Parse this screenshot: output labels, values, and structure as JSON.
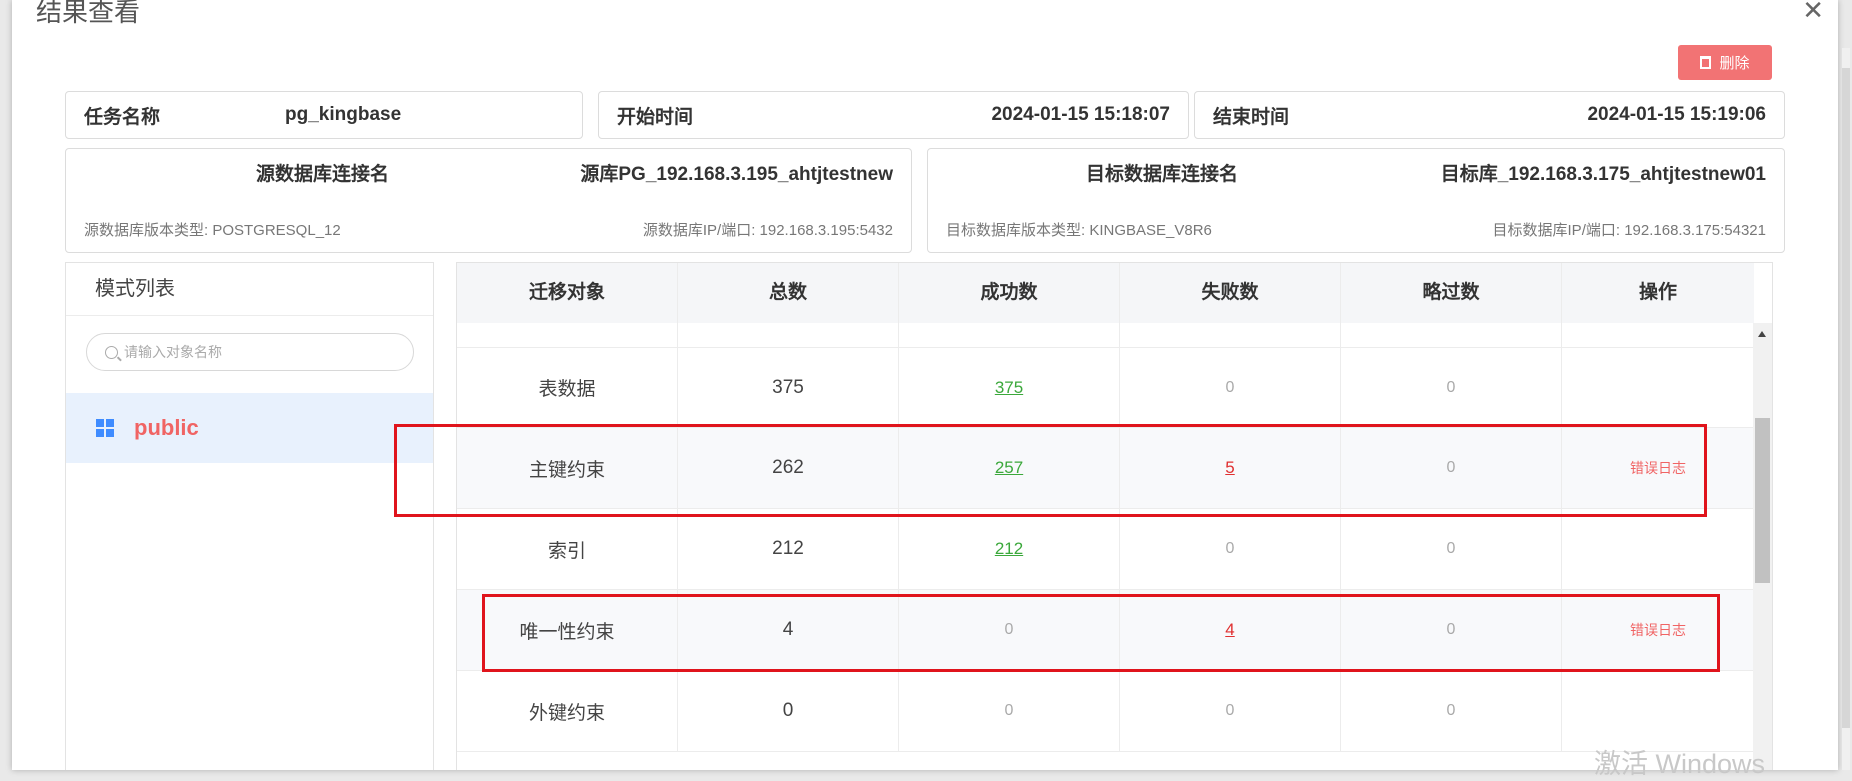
{
  "dialog": {
    "title": "结果查看",
    "close_icon": "close-icon",
    "delete_label": "删除"
  },
  "task": {
    "name_label": "任务名称",
    "name_value": "pg_kingbase",
    "start_label": "开始时间",
    "start_value": "2024-01-15 15:18:07",
    "end_label": "结束时间",
    "end_value": "2024-01-15 15:19:06"
  },
  "source": {
    "conn_label": "源数据库连接名",
    "conn_value": "源库PG_192.168.3.195_ahtjtestnew",
    "version": "源数据库版本类型:  POSTGRESQL_12",
    "ip": "源数据库IP/端口:   192.168.3.195:5432"
  },
  "target": {
    "conn_label": "目标数据库连接名",
    "conn_value": "目标库_192.168.3.175_ahtjtestnew01",
    "version": "目标数据库版本类型: KINGBASE_V8R6",
    "ip": "目标数据库IP/端口:   192.168.3.175:54321"
  },
  "sidebar": {
    "title": "模式列表",
    "search_placeholder": "请输入对象名称",
    "schema": "public"
  },
  "table": {
    "headers": [
      "迁移对象",
      "总数",
      "成功数",
      "失败数",
      "略过数",
      "操作"
    ],
    "rows": [
      {
        "object": "表数据",
        "total": "375",
        "success": "375",
        "fail": "0",
        "skip": "0",
        "action": ""
      },
      {
        "object": "主键约束",
        "total": "262",
        "success": "257",
        "fail": "5",
        "skip": "0",
        "action": "错误日志"
      },
      {
        "object": "索引",
        "total": "212",
        "success": "212",
        "fail": "0",
        "skip": "0",
        "action": ""
      },
      {
        "object": "唯一性约束",
        "total": "4",
        "success": "0",
        "fail": "4",
        "skip": "0",
        "action": "错误日志"
      },
      {
        "object": "外键约束",
        "total": "0",
        "success": "0",
        "fail": "0",
        "skip": "0",
        "action": ""
      }
    ]
  },
  "watermark": "激活 Windows",
  "colors": {
    "accent_red": "#f27374",
    "success_green": "#3ba83b",
    "fail_red": "#e03030",
    "selected_bg": "#e8f1fd"
  }
}
